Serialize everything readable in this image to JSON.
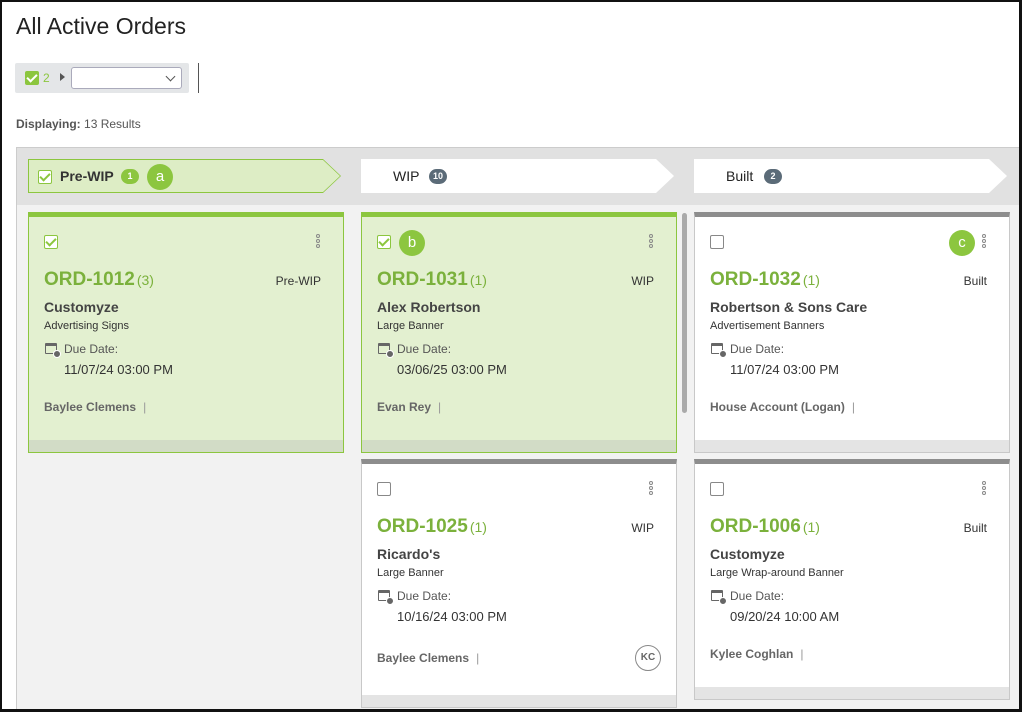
{
  "page": {
    "title": "All Active Orders"
  },
  "filter": {
    "checked_count": "2",
    "select_value": ""
  },
  "results": {
    "label": "Displaying:",
    "value": "13 Results"
  },
  "phases": [
    {
      "label": "Pre-WIP",
      "count": "1",
      "active": true
    },
    {
      "label": "WIP",
      "count": "10",
      "active": false
    },
    {
      "label": "Built",
      "count": "2",
      "active": false
    }
  ],
  "callouts": {
    "a": "a",
    "b": "b",
    "c": "c"
  },
  "cards": [
    {
      "order": "ORD-1012",
      "qty": "(3)",
      "status": "Pre-WIP",
      "customer": "Customyze",
      "product": "Advertising Signs",
      "due_label": "Due Date:",
      "due": "11/07/24 03:00 PM",
      "rep": "Baylee Clemens",
      "selected": true
    },
    {
      "order": "ORD-1031",
      "qty": "(1)",
      "status": "WIP",
      "customer": "Alex Robertson",
      "product": "Large Banner",
      "due_label": "Due Date:",
      "due": "03/06/25 03:00 PM",
      "rep": "Evan Rey",
      "selected": true
    },
    {
      "order": "ORD-1032",
      "qty": "(1)",
      "status": "Built",
      "customer": "Robertson & Sons Care",
      "product": "Advertisement Banners",
      "due_label": "Due Date:",
      "due": "11/07/24 03:00 PM",
      "rep": "House Account (Logan)",
      "selected": false
    },
    {
      "order": "ORD-1025",
      "qty": "(1)",
      "status": "WIP",
      "customer": "Ricardo's",
      "product": "Large Banner",
      "due_label": "Due Date:",
      "due": "10/16/24 03:00 PM",
      "rep": "Baylee Clemens",
      "avatar": "KC",
      "selected": false
    },
    {
      "order": "ORD-1006",
      "qty": "(1)",
      "status": "Built",
      "customer": "Customyze",
      "product": "Large Wrap-around Banner",
      "due_label": "Due Date:",
      "due": "09/20/24 10:00 AM",
      "rep": "Kylee Coghlan",
      "selected": false
    }
  ],
  "colors": {
    "accent": "#8cc63f",
    "order_number": "#7bb13c",
    "selected_bg": "#e3f0d0",
    "badge_gray": "#5b6b78"
  }
}
